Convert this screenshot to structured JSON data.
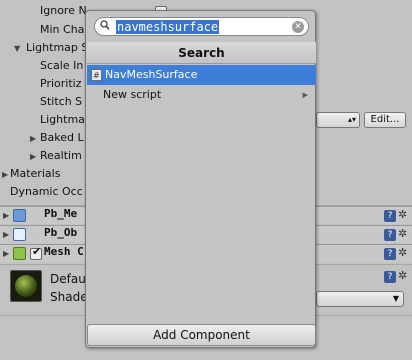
{
  "inspector": {
    "ignore_label": "Ignore N",
    "min_chart_label": "Min Cha",
    "lightmap_static_label": "Lightmap S",
    "scale_label": "Scale In",
    "prioritize_label": "Prioritiz",
    "stitch_label": "Stitch S",
    "lightmap_label": "Lightma",
    "baked_label": "Baked L",
    "realtime_label": "Realtim",
    "materials_label": "Materials",
    "dynamic_label": "Dynamic Occ",
    "edit_button": "Edit...",
    "components": [
      {
        "label": "Pb_Me"
      },
      {
        "label": "Pb_Ob"
      },
      {
        "label": "Mesh C"
      }
    ],
    "material_name": "Defau",
    "shader_label": "Shade"
  },
  "popup": {
    "search_value": "navmeshsurface",
    "header": "Search",
    "results": [
      {
        "label": "NavMeshSurface",
        "selected": true
      },
      {
        "label": "New script",
        "selected": false
      }
    ],
    "add_component_label": "Add Component"
  },
  "colors": {
    "selection": "#3e7ed8",
    "panel": "#c2c2c2"
  }
}
